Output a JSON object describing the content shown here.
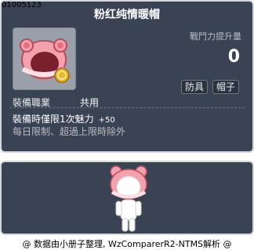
{
  "item": {
    "id": "01005123",
    "name": "粉红纯情暖帽",
    "attack_increase_label": "戰鬥力提升量",
    "attack_increase_value": "0",
    "tags": [
      "防具",
      "帽子"
    ],
    "job_label": "裝備職業",
    "job_value": "共用",
    "bonus_label": "裝備時僅限1次魅力",
    "bonus_value": "+50",
    "limit_text": "每日限制、超過上限時除外"
  },
  "footer": {
    "credit": "@ 数据由小册子整理, WzComparerR2-NTMS解析 @"
  },
  "icon": {
    "hat_icon": "pink-bear-hat-icon",
    "coin_icon": "gold-coin-icon",
    "preview_character": "character-preview"
  },
  "colors": {
    "panel_bg": "#3a4353",
    "panel_border": "#d4d7dc",
    "hat_pink": "#f08f9a",
    "coin_gold": "#e8b52b"
  }
}
